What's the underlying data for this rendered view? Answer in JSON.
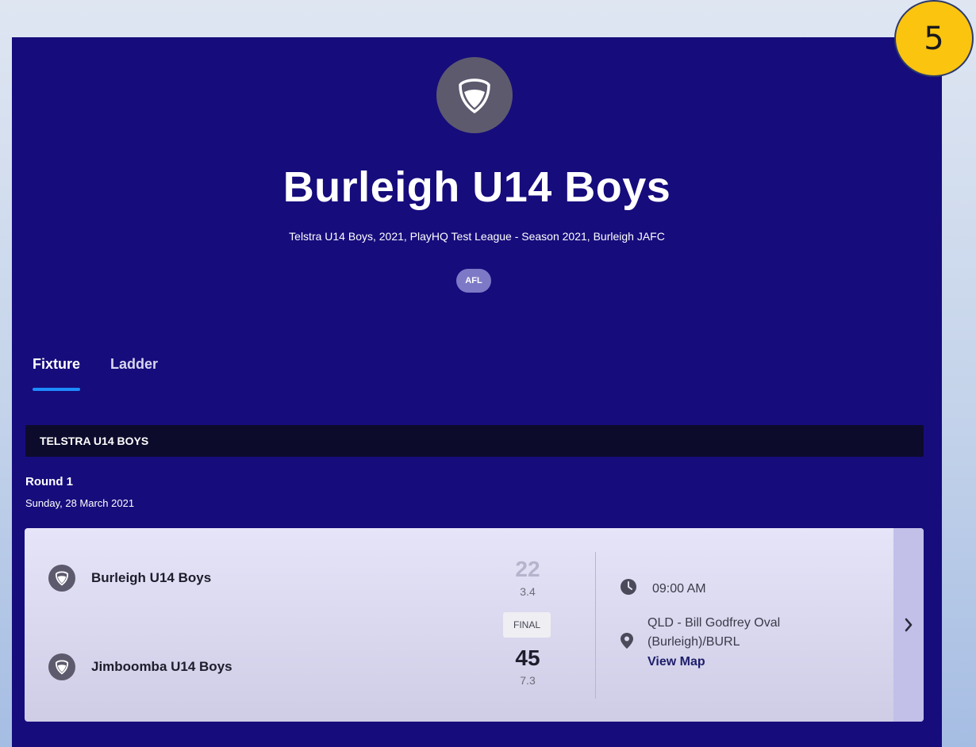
{
  "step_badge": "5",
  "team": {
    "title": "Burleigh U14 Boys",
    "subtitle": "Telstra U14 Boys, 2021, PlayHQ Test League - Season 2021, Burleigh JAFC",
    "sport": "AFL"
  },
  "tabs": [
    {
      "label": "Fixture",
      "active": true
    },
    {
      "label": "Ladder",
      "active": false
    }
  ],
  "competition": {
    "header": "TELSTRA U14 BOYS"
  },
  "round": {
    "title": "Round 1",
    "date": "Sunday, 28 March 2021"
  },
  "match": {
    "home": {
      "name": "Burleigh U14 Boys",
      "score": "22",
      "detail": "3.4"
    },
    "away": {
      "name": "Jimboomba U14 Boys",
      "score": "45",
      "detail": "7.3"
    },
    "status": "FINAL",
    "time": "09:00 AM",
    "venue_line1": "QLD - Bill Godfrey Oval",
    "venue_line2": "(Burleigh)/BURL",
    "view_map": "View Map"
  },
  "colors": {
    "page_bg": "#160c7c",
    "tab_underline": "#1d8cff",
    "badge": "#fbc40f",
    "card_bg": "#e6e4f8"
  },
  "icons": {
    "logo": "shield-icon",
    "time": "clock-icon",
    "venue": "map-pin-icon",
    "arrow": "chevron-right-icon"
  }
}
